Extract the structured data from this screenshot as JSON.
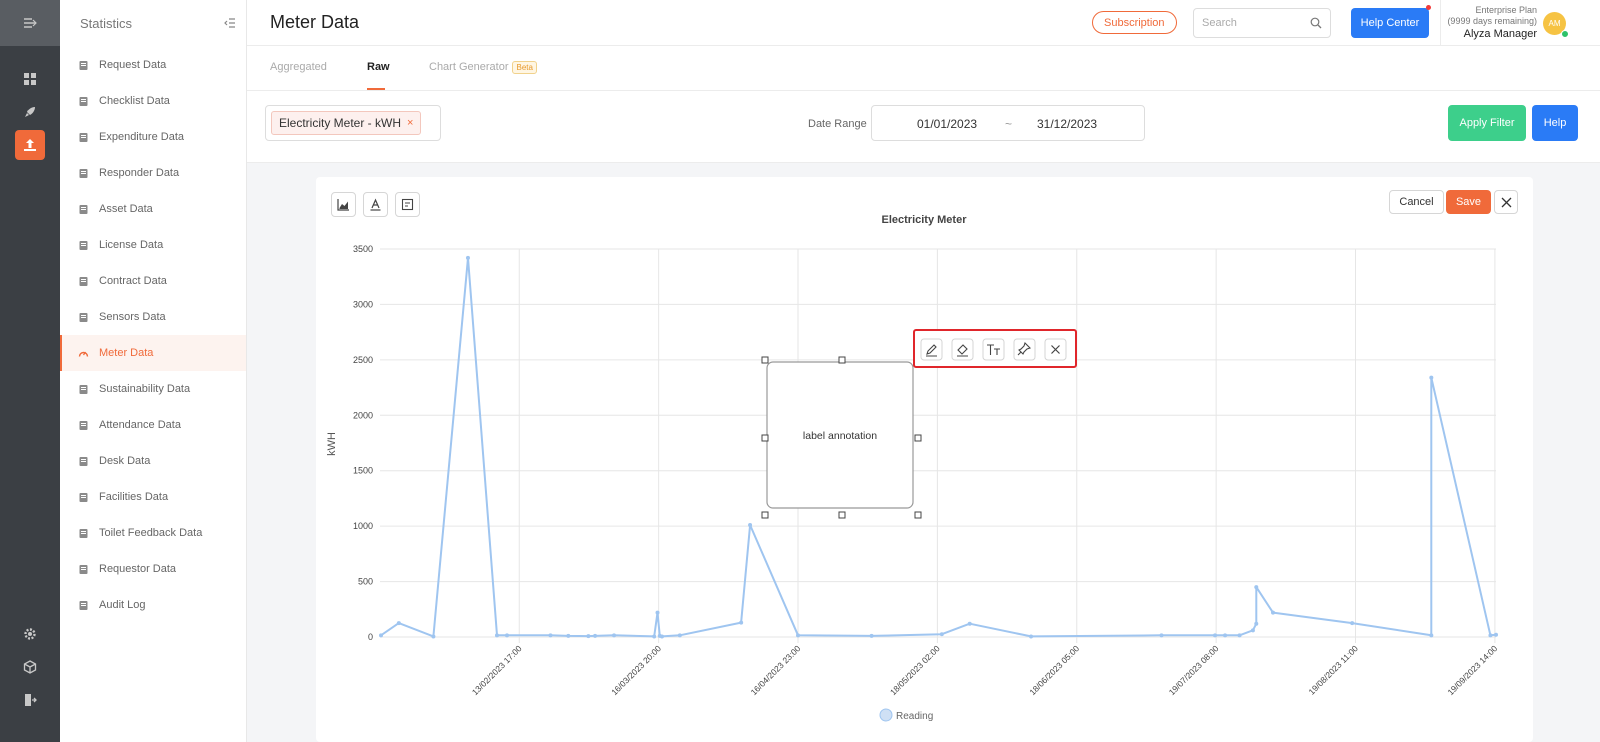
{
  "sidebar": {
    "title": "Statistics",
    "items": [
      {
        "label": "Request Data",
        "icon": "request-icon"
      },
      {
        "label": "Checklist Data",
        "icon": "checklist-icon"
      },
      {
        "label": "Expenditure Data",
        "icon": "expenditure-icon"
      },
      {
        "label": "Responder Data",
        "icon": "responder-icon"
      },
      {
        "label": "Asset Data",
        "icon": "asset-icon"
      },
      {
        "label": "License Data",
        "icon": "license-icon"
      },
      {
        "label": "Contract Data",
        "icon": "contract-icon"
      },
      {
        "label": "Sensors Data",
        "icon": "sensors-icon"
      },
      {
        "label": "Meter Data",
        "icon": "meter-icon",
        "active": true
      },
      {
        "label": "Sustainability Data",
        "icon": "sustainability-icon"
      },
      {
        "label": "Attendance Data",
        "icon": "attendance-icon"
      },
      {
        "label": "Desk Data",
        "icon": "desk-icon"
      },
      {
        "label": "Facilities Data",
        "icon": "facilities-icon"
      },
      {
        "label": "Toilet Feedback Data",
        "icon": "feedback-icon"
      },
      {
        "label": "Requestor Data",
        "icon": "requestor-icon"
      },
      {
        "label": "Audit Log",
        "icon": "audit-icon"
      }
    ]
  },
  "header": {
    "title": "Meter Data",
    "subscription_label": "Subscription",
    "search_placeholder": "Search",
    "help_center_label": "Help Center",
    "plan_name": "Enterprise Plan",
    "plan_remaining": "(9999 days remaining)",
    "user_name": "Alyza Manager",
    "avatar_initials": "AM"
  },
  "tabs": {
    "aggregated": "Aggregated",
    "raw": "Raw",
    "chart_generator": "Chart Generator",
    "beta_badge": "Beta"
  },
  "filters": {
    "meter_chip": "Electricity Meter - kWH",
    "chip_remove": "×",
    "date_range_label": "Date Range",
    "date_from": "01/01/2023",
    "date_sep": "~",
    "date_to": "31/12/2023",
    "apply_label": "Apply Filter",
    "help_label": "Help"
  },
  "editor": {
    "cancel_label": "Cancel",
    "save_label": "Save",
    "annotation_text": "label annotation"
  },
  "colors": {
    "accent": "#f06a3a",
    "primary": "#2a7bf6",
    "success": "#3dcf8b",
    "series": "#9fc5f0"
  },
  "chart_data": {
    "type": "line",
    "title": "Electricity Meter",
    "xlabel": "",
    "ylabel": "kWH",
    "ylim": [
      0,
      3500
    ],
    "yticks": [
      0,
      500,
      1000,
      1500,
      2000,
      2500,
      3000,
      3500
    ],
    "xticks": [
      "13/02/2023 17:00",
      "16/03/2023 20:00",
      "16/04/2023 23:00",
      "18/05/2023 02:00",
      "18/06/2023 05:00",
      "19/07/2023 08:00",
      "19/08/2023 11:00",
      "19/09/2023 14:00"
    ],
    "grid": true,
    "legend_position": "bottom",
    "series": [
      {
        "name": "Reading",
        "points": [
          [
            "2023-01-05T00:00",
            15
          ],
          [
            "2023-01-18T00:00",
            125
          ],
          [
            "2023-02-01T00:00",
            5
          ],
          [
            "2023-02-09T00:00",
            3420
          ],
          [
            "2023-02-17T00:00",
            15
          ],
          [
            "2023-02-20T00:00",
            15
          ],
          [
            "2023-03-02T00:00",
            15
          ],
          [
            "2023-03-07T00:00",
            10
          ],
          [
            "2023-03-13T00:00",
            8
          ],
          [
            "2023-03-15T00:00",
            10
          ],
          [
            "2023-03-21T00:00",
            15
          ],
          [
            "2023-03-28T00:00",
            5
          ],
          [
            "2023-03-28T12:00",
            220
          ],
          [
            "2023-03-29T00:00",
            10
          ],
          [
            "2023-03-30T00:00",
            5
          ],
          [
            "2023-04-04T00:00",
            15
          ],
          [
            "2023-04-22T00:00",
            130
          ],
          [
            "2023-04-25T00:00",
            1010
          ],
          [
            "2023-05-08T00:00",
            15
          ],
          [
            "2023-05-29T00:00",
            10
          ],
          [
            "2023-06-18T00:00",
            25
          ],
          [
            "2023-06-26T00:00",
            120
          ],
          [
            "2023-07-14T00:00",
            5
          ],
          [
            "2023-08-21T00:00",
            15
          ],
          [
            "2023-08-35T00:00",
            10
          ]
        ],
        "values_by_tick_fraction": [
          [
            0.0,
            15
          ],
          [
            0.016,
            125
          ],
          [
            0.047,
            5
          ],
          [
            0.078,
            3420
          ],
          [
            0.104,
            15
          ],
          [
            0.113,
            15
          ],
          [
            0.152,
            15
          ],
          [
            0.168,
            10
          ],
          [
            0.186,
            8
          ],
          [
            0.192,
            10
          ],
          [
            0.209,
            15
          ],
          [
            0.245,
            5
          ],
          [
            0.248,
            220
          ],
          [
            0.25,
            10
          ],
          [
            0.252,
            5
          ],
          [
            0.268,
            15
          ],
          [
            0.323,
            130
          ],
          [
            0.331,
            1010
          ],
          [
            0.374,
            15
          ],
          [
            0.44,
            10
          ],
          [
            0.503,
            25
          ],
          [
            0.528,
            120
          ],
          [
            0.583,
            5
          ],
          [
            0.7,
            15
          ],
          [
            0.748,
            15
          ],
          [
            0.757,
            15
          ],
          [
            0.77,
            15
          ],
          [
            0.782,
            60
          ],
          [
            0.785,
            120
          ],
          [
            0.785,
            450
          ],
          [
            0.8,
            220
          ],
          [
            0.871,
            125
          ],
          [
            0.942,
            15
          ],
          [
            0.942,
            2340
          ],
          [
            0.995,
            15
          ],
          [
            1.0,
            20
          ]
        ]
      }
    ]
  }
}
